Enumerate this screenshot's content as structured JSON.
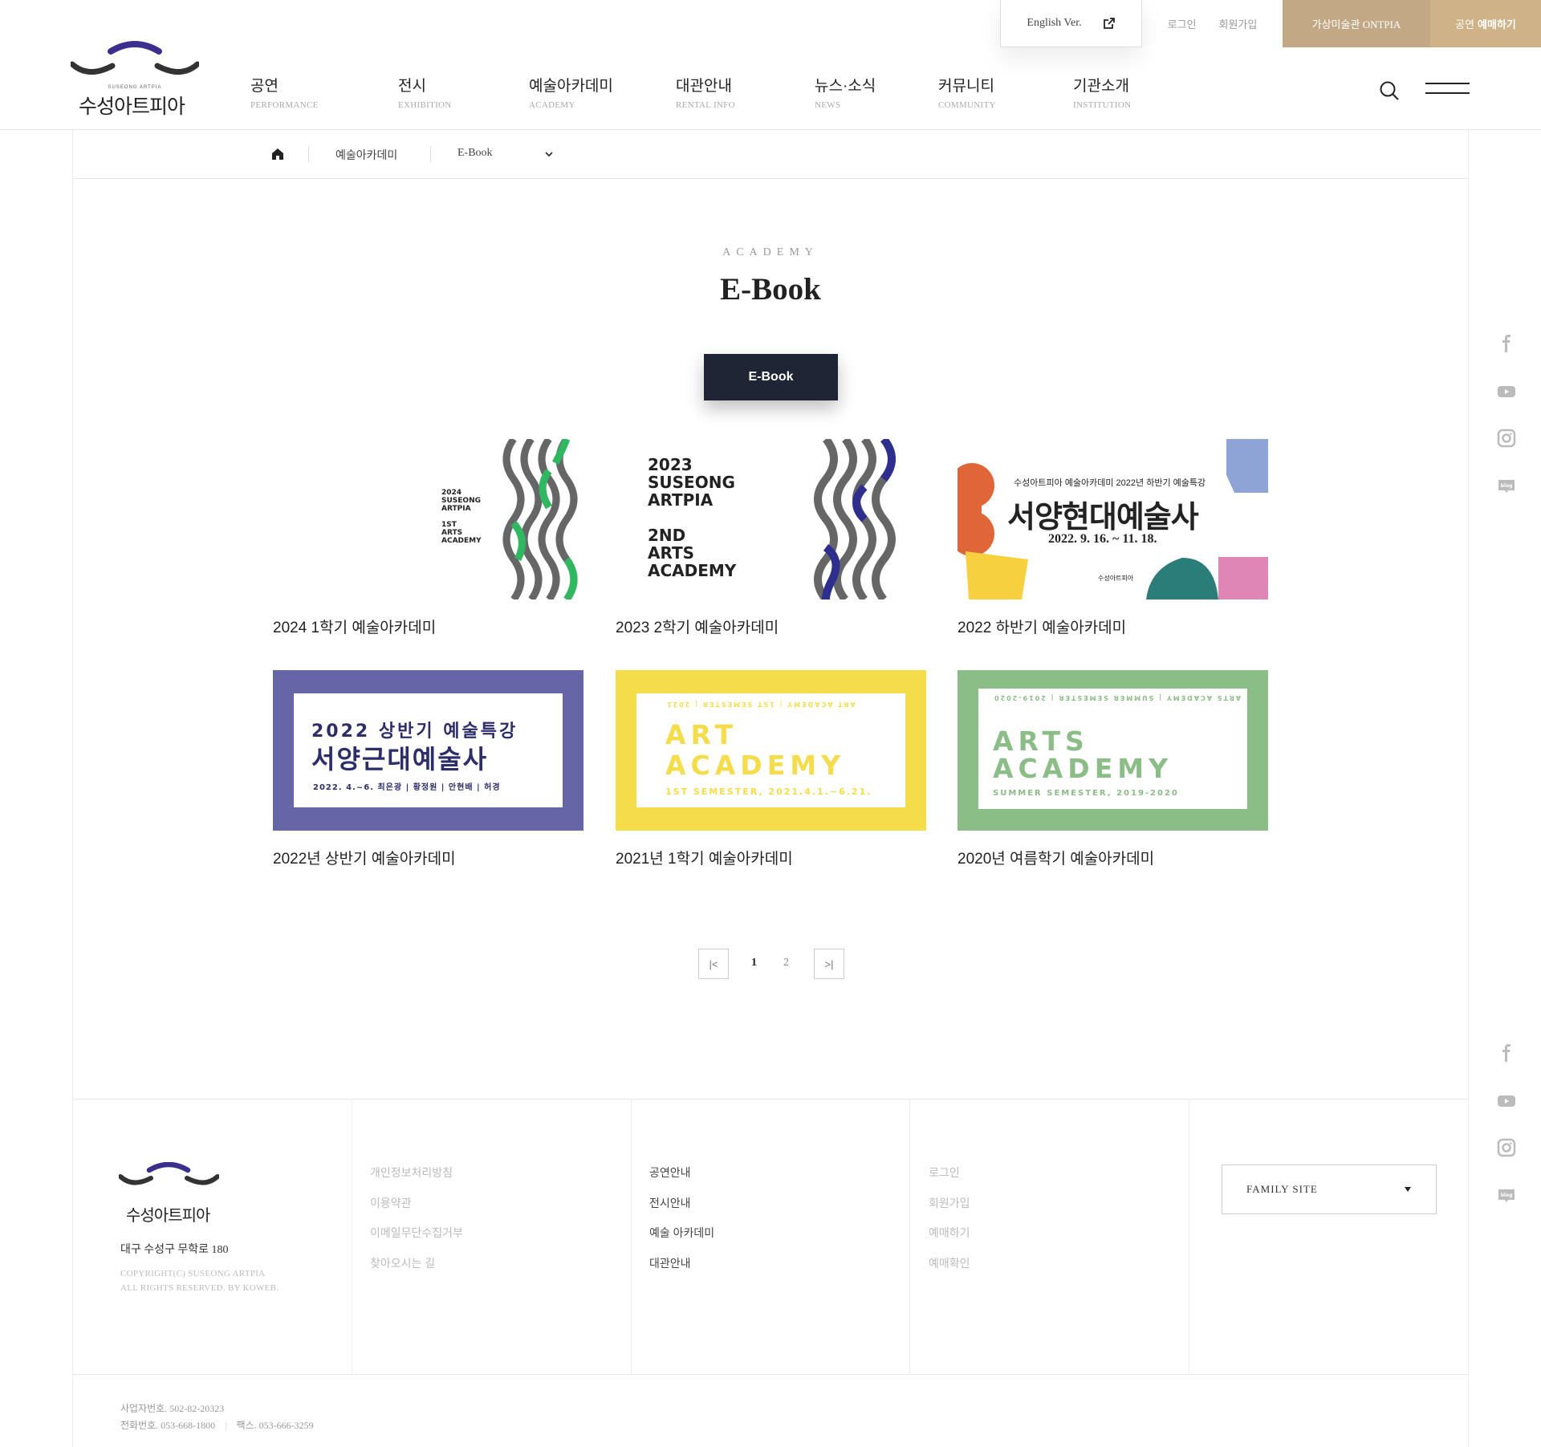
{
  "utility": {
    "english": "English Ver.",
    "login": "로그인",
    "join": "회원가입",
    "ontpia": "가상미술관 ONTPIA",
    "ticket_pre": "공연",
    "ticket_main": "예매하기"
  },
  "logo": {
    "small": "SUSEONG ARTPIA",
    "text": "수성아트피아"
  },
  "gnb": [
    {
      "ko": "공연",
      "en": "PERFORMANCE"
    },
    {
      "ko": "전시",
      "en": "EXHIBITION"
    },
    {
      "ko": "예술아카데미",
      "en": "ACADEMY"
    },
    {
      "ko": "대관안내",
      "en": "RENTAL INFO"
    },
    {
      "ko": "뉴스·소식",
      "en": "NEWS"
    },
    {
      "ko": "커뮤니티",
      "en": "COMMUNITY"
    },
    {
      "ko": "기관소개",
      "en": "INSTITUTION"
    }
  ],
  "breadcrumb": {
    "level1": "예술아카데미",
    "level2": "E-Book"
  },
  "page": {
    "subtitle": "ACADEMY",
    "title": "E-Book",
    "tab": "E-Book"
  },
  "cards": [
    {
      "caption": "2024 1학기 예술아카데미",
      "thumb": [
        "2024",
        "SUSEONG",
        "ARTPIA",
        "1ST",
        "ARTS",
        "ACADEMY"
      ]
    },
    {
      "caption": "2023 2학기 예술아카데미",
      "thumb": [
        "2023",
        "SUSEONG",
        "ARTPIA",
        "2ND",
        "ARTS",
        "ACADEMY"
      ]
    },
    {
      "caption": "2022 하반기 예술아카데미",
      "thumb": [
        "수성아트피아 예술아카데미 2022년 하반기 예술특강",
        "서양현대예술사",
        "2022. 9. 16. ~ 11. 18.",
        "수성아트피아"
      ]
    },
    {
      "caption": "2022년 상반기 예술아카데미",
      "thumb": [
        "2022 상반기 예술특강",
        "서양근대예술사",
        "2022. 4.~6. 최은광 | 황정원 | 안현배 | 허경"
      ]
    },
    {
      "caption": "2021년 1학기 예술아카데미",
      "thumb": [
        "ART",
        "ACADEMY",
        "1ST SEMESTER, 2021.4.1.~6.21.",
        "ART ACADEMY | 1ST SEMESTER | 2021"
      ]
    },
    {
      "caption": "2020년 여름학기 예술아카데미",
      "thumb": [
        "ARTS",
        "ACADEMY",
        "SUMMER SEMESTER, 2019-2020",
        "ARTS ACADEMY | SUMMER SEMESTER | 2019-2020"
      ]
    }
  ],
  "pagination": {
    "first": "|<",
    "last": ">|",
    "pages": [
      "1",
      "2"
    ],
    "current": "1"
  },
  "colors": {
    "brand_purple": "#3a2f8c",
    "nav_dark": "#1f2535",
    "gold": "#c3a885",
    "card4_bg": "#6565a8",
    "card5_bg": "#f5dc4a",
    "card6_bg": "#8bbd87"
  },
  "footer": {
    "logo_text": "수성아트피아",
    "address": "대구 수성구 무학로 180",
    "copyright1": "COPYRIGHT(C) SUSEONG ARTPIA",
    "copyright2": "ALL RIGHTS RESERVED. BY KOWEB.",
    "col1": [
      "개인정보처리방침",
      "이용약관",
      "이메일무단수집거부",
      "찾아오시는 길"
    ],
    "col2": [
      "공연안내",
      "전시안내",
      "예술 아카데미",
      "대관안내"
    ],
    "col3": [
      "로그인",
      "회원가입",
      "예매하기",
      "예매확인"
    ],
    "family": "FAMILY SITE",
    "biz_no": "사업자번호. 502-82-20323",
    "tel": "전화번호. 053-668-1800",
    "fax": "팩스. 053-666-3259"
  },
  "sns": [
    "facebook-icon",
    "youtube-icon",
    "instagram-icon",
    "blog-icon"
  ]
}
